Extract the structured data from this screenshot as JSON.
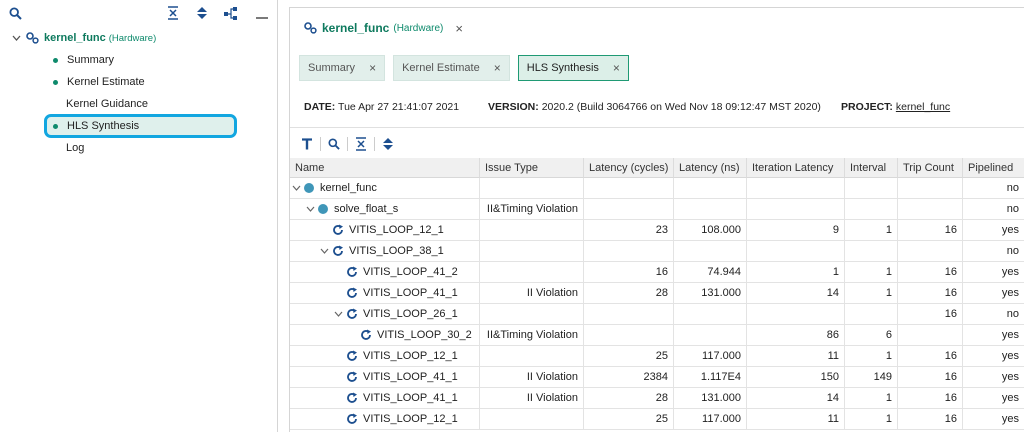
{
  "explorer": {
    "root_label": "kernel_func",
    "root_sub": "(Hardware)",
    "items": [
      {
        "label": "Summary",
        "dot": true
      },
      {
        "label": "Kernel Estimate",
        "dot": true
      },
      {
        "label": "Kernel Guidance",
        "dot": false
      },
      {
        "label": "HLS Synthesis",
        "dot": true,
        "selected": true
      },
      {
        "label": "Log",
        "dot": false
      }
    ]
  },
  "editor": {
    "title": "kernel_func",
    "sub": "(Hardware)",
    "close": "×"
  },
  "subtabs": [
    {
      "label": "Summary",
      "close": "×"
    },
    {
      "label": "Kernel Estimate",
      "close": "×"
    },
    {
      "label": "HLS Synthesis",
      "close": "×",
      "active": true
    }
  ],
  "info": {
    "date_label": "DATE:",
    "date_value": "Tue Apr 27 21:41:07 2021",
    "version_label": "VERSION:",
    "version_value": "2020.2 (Build 3064766 on Wed Nov 18 09:12:47 MST 2020)",
    "project_label": "PROJECT:",
    "project_value": "kernel_func"
  },
  "table": {
    "columns": [
      "Name",
      "Issue Type",
      "Latency (cycles)",
      "Latency (ns)",
      "Iteration Latency",
      "Interval",
      "Trip Count",
      "Pipelined"
    ],
    "rows": [
      {
        "name": "kernel_func",
        "issue": "",
        "lat_c": "",
        "lat_ns": "",
        "iter": "",
        "interval": "",
        "trip": "",
        "pipe": "no"
      },
      {
        "name": "solve_float_s",
        "issue": "II&Timing Violation",
        "lat_c": "",
        "lat_ns": "",
        "iter": "",
        "interval": "",
        "trip": "",
        "pipe": "no"
      },
      {
        "name": "VITIS_LOOP_12_1",
        "issue": "",
        "lat_c": "23",
        "lat_ns": "108.000",
        "iter": "9",
        "interval": "1",
        "trip": "16",
        "pipe": "yes"
      },
      {
        "name": "VITIS_LOOP_38_1",
        "issue": "",
        "lat_c": "",
        "lat_ns": "",
        "iter": "",
        "interval": "",
        "trip": "",
        "pipe": "no"
      },
      {
        "name": "VITIS_LOOP_41_2",
        "issue": "",
        "lat_c": "16",
        "lat_ns": "74.944",
        "iter": "1",
        "interval": "1",
        "trip": "16",
        "pipe": "yes"
      },
      {
        "name": "VITIS_LOOP_41_1",
        "issue": "II Violation",
        "lat_c": "28",
        "lat_ns": "131.000",
        "iter": "14",
        "interval": "1",
        "trip": "16",
        "pipe": "yes"
      },
      {
        "name": "VITIS_LOOP_26_1",
        "issue": "",
        "lat_c": "",
        "lat_ns": "",
        "iter": "",
        "interval": "",
        "trip": "16",
        "pipe": "no"
      },
      {
        "name": "VITIS_LOOP_30_2",
        "issue": "II&Timing Violation",
        "lat_c": "",
        "lat_ns": "",
        "iter": "86",
        "interval": "6",
        "trip": "",
        "pipe": "yes"
      },
      {
        "name": "VITIS_LOOP_12_1",
        "issue": "",
        "lat_c": "25",
        "lat_ns": "117.000",
        "iter": "11",
        "interval": "1",
        "trip": "16",
        "pipe": "yes"
      },
      {
        "name": "VITIS_LOOP_41_1",
        "issue": "II Violation",
        "lat_c": "2384",
        "lat_ns": "1.117E4",
        "iter": "150",
        "interval": "149",
        "trip": "16",
        "pipe": "yes"
      },
      {
        "name": "VITIS_LOOP_41_1",
        "issue": "II Violation",
        "lat_c": "28",
        "lat_ns": "131.000",
        "iter": "14",
        "interval": "1",
        "trip": "16",
        "pipe": "yes"
      },
      {
        "name": "VITIS_LOOP_12_1",
        "issue": "",
        "lat_c": "25",
        "lat_ns": "117.000",
        "iter": "11",
        "interval": "1",
        "trip": "16",
        "pipe": "yes"
      }
    ]
  },
  "colors": {
    "accent": "#0e8a6c",
    "highlight_border": "#12a6e0",
    "icon_blue": "#1d4f8f"
  }
}
